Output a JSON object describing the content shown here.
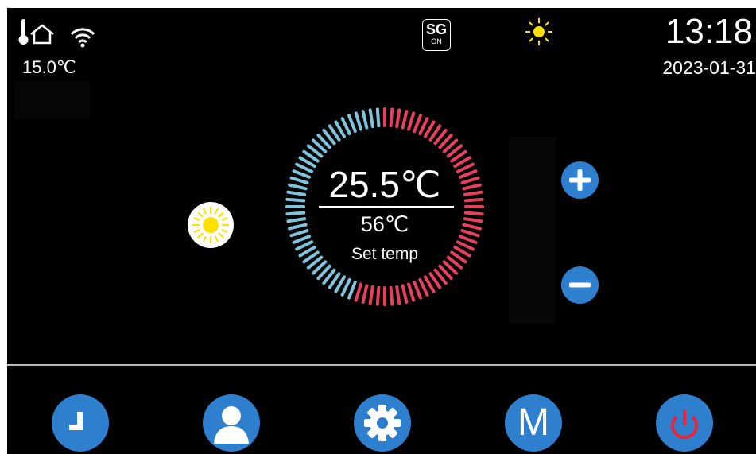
{
  "status_bar": {
    "outdoor_temp": "15.0℃",
    "sg_top": "SG",
    "sg_bottom": "ON",
    "clock": "13:18",
    "date": "2023-01-31",
    "icons": [
      "thermometer-home-icon",
      "wifi-icon",
      "sg-ready-icon",
      "sun-status-icon"
    ]
  },
  "main": {
    "current_temp": "25.5℃",
    "water_temp": "56℃",
    "set_label": "Set temp",
    "mode_icon": "sun-icon",
    "dial_colors": {
      "cool": "#7fc4dc",
      "warm": "#e8405c"
    }
  },
  "controls": {
    "increase_icon": "plus-icon",
    "decrease_icon": "minus-icon"
  },
  "bottom_nav": {
    "items": [
      {
        "icon": "clock-icon"
      },
      {
        "icon": "user-icon"
      },
      {
        "icon": "gear-icon"
      },
      {
        "icon": "mode-icon",
        "label": "M"
      },
      {
        "icon": "power-icon"
      }
    ]
  },
  "colors": {
    "accent": "#2f7fcf",
    "power": "#e8263a",
    "sun": "#ffe100",
    "background": "#000000"
  }
}
